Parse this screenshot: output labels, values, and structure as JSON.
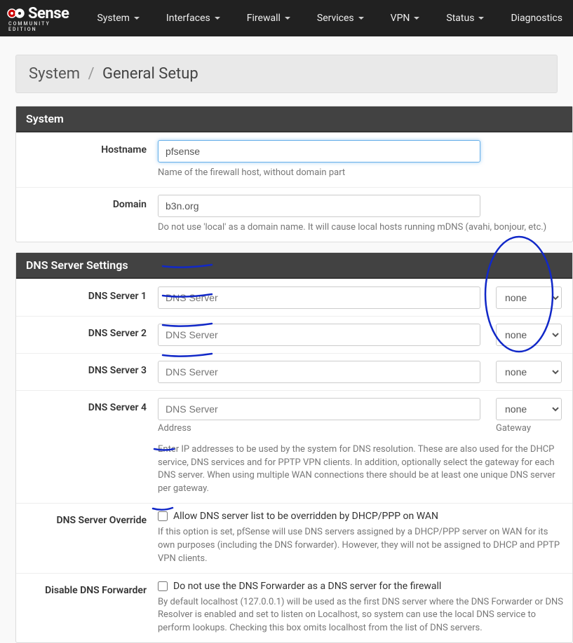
{
  "nav": {
    "items": [
      "System",
      "Interfaces",
      "Firewall",
      "Services",
      "VPN",
      "Status",
      "Diagnostics"
    ]
  },
  "logo": {
    "main": "Sense",
    "sub": "COMMUNITY EDITION"
  },
  "breadcrumb": {
    "root": "System",
    "current": "General Setup"
  },
  "panel_system": {
    "title": "System",
    "hostname_label": "Hostname",
    "hostname_value": "pfsense",
    "hostname_help": "Name of the firewall host, without domain part",
    "domain_label": "Domain",
    "domain_value": "b3n.org",
    "domain_help": "Do not use 'local' as a domain name. It will cause local hosts running mDNS (avahi, bonjour, etc.)"
  },
  "panel_dns": {
    "title": "DNS Server Settings",
    "rows": [
      {
        "label": "DNS Server 1",
        "placeholder": "DNS Server",
        "gw": "none"
      },
      {
        "label": "DNS Server 2",
        "placeholder": "DNS Server",
        "gw": "none"
      },
      {
        "label": "DNS Server 3",
        "placeholder": "DNS Server",
        "gw": "none"
      },
      {
        "label": "DNS Server 4",
        "placeholder": "DNS Server",
        "gw": "none"
      }
    ],
    "col_addr": "Address",
    "col_gw": "Gateway",
    "help": "Enter IP addresses to be used by the system for DNS resolution. These are also used for the DHCP service, DNS services and for PPTP VPN clients. In addition, optionally select the gateway for each DNS server. When using multiple WAN connections there should be at least one unique DNS server per gateway.",
    "override_label": "DNS Server Override",
    "override_chk": "Allow DNS server list to be overridden by DHCP/PPP on WAN",
    "override_help": "If this option is set, pfSense will use DNS servers assigned by a DHCP/PPP server on WAN for its own purposes (including the DNS forwarder). However, they will not be assigned to DHCP and PPTP VPN clients.",
    "disable_label": "Disable DNS Forwarder",
    "disable_chk": "Do not use the DNS Forwarder as a DNS server for the firewall",
    "disable_help": "By default localhost (127.0.0.1) will be used as the first DNS server where the DNS Forwarder or DNS Resolver is enabled and set to listen on Localhost, so system can use the local DNS service to perform lookups. Checking this box omits localhost from the list of DNS servers."
  }
}
